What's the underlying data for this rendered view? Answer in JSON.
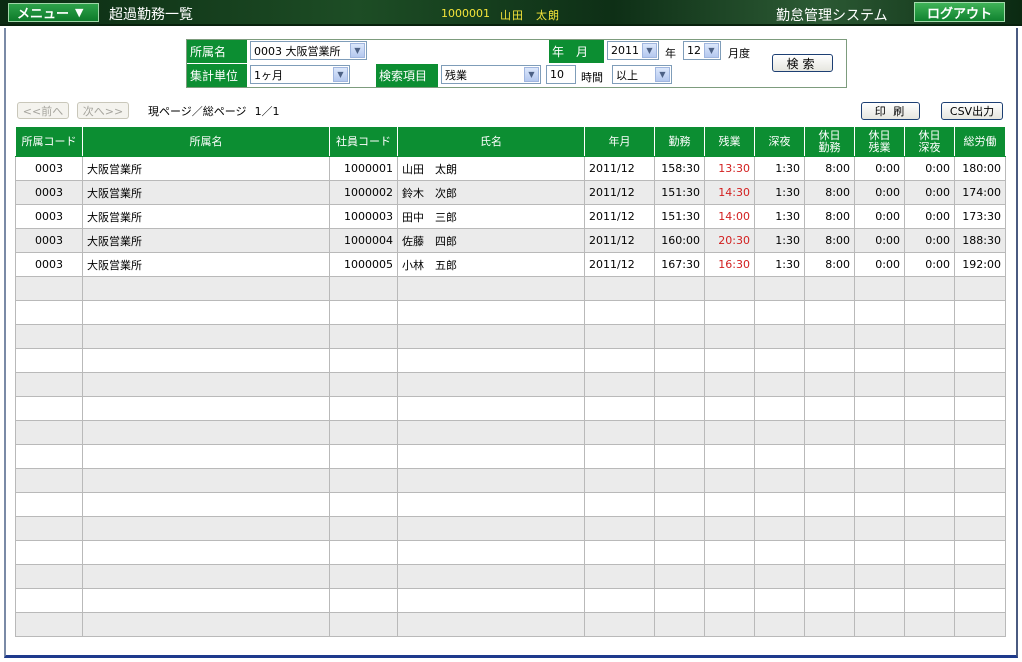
{
  "header": {
    "menu_label": "メニュー",
    "menu_arrow": "▼",
    "page_title": "超過勤務一覧",
    "user_id": "1000001",
    "user_name": "山田　太朗",
    "system_name": "勤怠管理システム",
    "logout_label": "ログアウト"
  },
  "search": {
    "dept_label": "所属名",
    "dept_value": "0003 大阪営業所",
    "yearmonth_label": "年　月",
    "year_value": "2011",
    "year_suffix": "年",
    "month_value": "12",
    "month_suffix": "月度",
    "unit_label": "集計単位",
    "unit_value": "1ヶ月",
    "item_label": "検索項目",
    "item_value": "残業",
    "hours_value": "10",
    "hours_suffix": "時間",
    "condition_value": "以上",
    "search_button": "検索"
  },
  "pager": {
    "prev_label": "<<前へ",
    "next_label": "次へ>>",
    "page_text": "現ページ／総ページ",
    "page_value": "1／1",
    "print_label": "印 刷",
    "csv_label": "CSV出力"
  },
  "table": {
    "columns": [
      "所属コード",
      "所属名",
      "社員コード",
      "氏名",
      "年月",
      "勤務",
      "残業",
      "深夜",
      "休日\n勤務",
      "休日\n残業",
      "休日\n深夜",
      "総労働"
    ],
    "rows": [
      [
        "0003",
        "大阪営業所",
        "1000001",
        "山田　太朗",
        "2011/12",
        "158:30",
        "13:30",
        "1:30",
        "8:00",
        "0:00",
        "0:00",
        "180:00"
      ],
      [
        "0003",
        "大阪営業所",
        "1000002",
        "鈴木　次郎",
        "2011/12",
        "151:30",
        "14:30",
        "1:30",
        "8:00",
        "0:00",
        "0:00",
        "174:00"
      ],
      [
        "0003",
        "大阪営業所",
        "1000003",
        "田中　三郎",
        "2011/12",
        "151:30",
        "14:00",
        "1:30",
        "8:00",
        "0:00",
        "0:00",
        "173:30"
      ],
      [
        "0003",
        "大阪営業所",
        "1000004",
        "佐藤　四郎",
        "2011/12",
        "160:00",
        "20:30",
        "1:30",
        "8:00",
        "0:00",
        "0:00",
        "188:30"
      ],
      [
        "0003",
        "大阪営業所",
        "1000005",
        "小林　五郎",
        "2011/12",
        "167:30",
        "16:30",
        "1:30",
        "8:00",
        "0:00",
        "0:00",
        "192:00"
      ]
    ],
    "empty_rows": 15
  },
  "colors": {
    "header_green": "#0c8e32",
    "overtime_red": "#d21f1f",
    "user_yellow": "#f4e43a"
  }
}
